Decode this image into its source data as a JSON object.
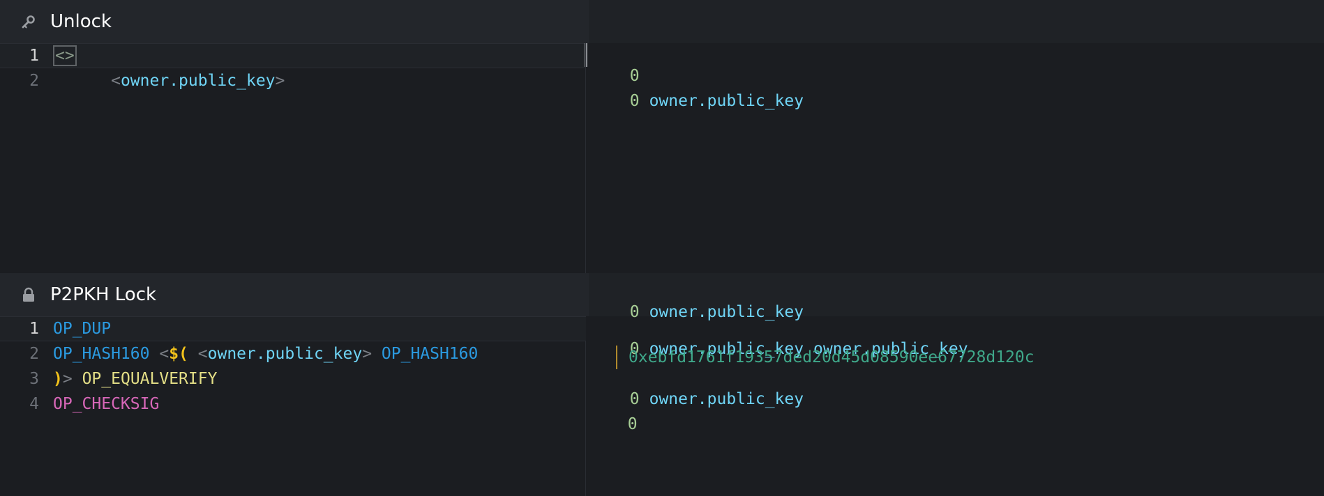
{
  "unlock": {
    "title": "Unlock",
    "icon": "key-icon",
    "lines": [
      {
        "num": "1",
        "empty_push_label": "<>"
      },
      {
        "num": "2",
        "open": "<",
        "var": "owner.public_key",
        "close": ">"
      }
    ]
  },
  "lock": {
    "title": "P2PKH Lock",
    "icon": "lock-icon",
    "lines": [
      {
        "num": "1",
        "op1": "OP_DUP"
      },
      {
        "num": "2",
        "op1": "OP_HASH160",
        "open": "<",
        "eval_open": "$(",
        "inner_open": "<",
        "var": "owner.public_key",
        "inner_close": ">",
        "op2": "OP_HASH160"
      },
      {
        "num": "3",
        "eval_close": ")",
        "close": ">",
        "op1": "OP_EQUALVERIFY"
      },
      {
        "num": "4",
        "op1": "OP_CHECKSIG"
      }
    ]
  },
  "unlock_states": [
    {
      "items": [
        "0"
      ]
    },
    {
      "items": [
        "0",
        "owner.public_key"
      ]
    }
  ],
  "lock_states": {
    "header_state": {
      "items": [
        "0",
        "owner.public_key"
      ]
    },
    "line1": {
      "items": [
        "0",
        "owner.public_key",
        "owner.public_key"
      ]
    },
    "line2_hash": "0xebfd1761f19357ded20d45d08590ee67728d120c",
    "line3": {
      "items": [
        "0",
        "owner.public_key"
      ]
    },
    "line4": {
      "items": [
        "0"
      ]
    }
  },
  "colors": {
    "background": "#1b1d21",
    "header": "#23262b",
    "opcode_blue": "#2b9ae0",
    "opcode_yellow": "#e3de86",
    "opcode_pink": "#d767b8",
    "variable": "#6fd4f5",
    "number": "#a8cf96",
    "hash": "#3fa88a"
  }
}
